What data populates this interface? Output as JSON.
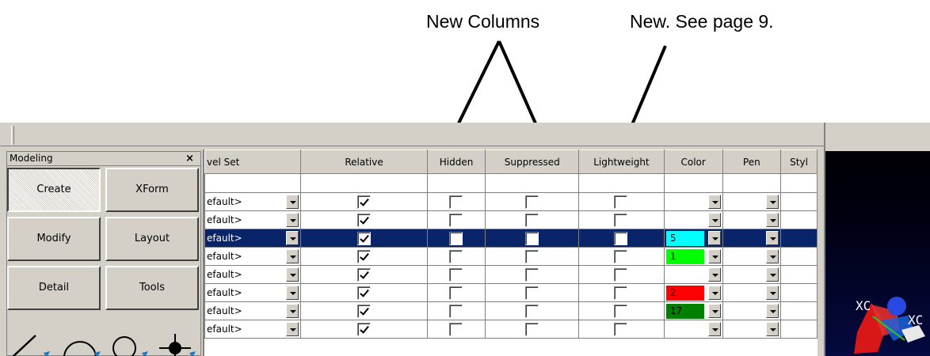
{
  "callouts": [
    {
      "text": "New Columns"
    },
    {
      "text": "New. See page 9."
    }
  ],
  "palette": {
    "title": "Modeling",
    "close_label": "×",
    "buttons": [
      {
        "label": "Create",
        "pressed": true
      },
      {
        "label": "XForm",
        "pressed": false
      },
      {
        "label": "Modify",
        "pressed": false
      },
      {
        "label": "Layout",
        "pressed": false
      },
      {
        "label": "Detail",
        "pressed": false
      },
      {
        "label": "Tools",
        "pressed": false
      }
    ],
    "tool_icons": [
      "line-icon",
      "arc-icon",
      "circle-icon",
      "point-icon"
    ]
  },
  "grid": {
    "columns": [
      "vel Set",
      "Relative",
      "Hidden",
      "Suppressed",
      "Lightweight",
      "Color",
      "Pen",
      "Styl"
    ],
    "rows": [
      {
        "level": "efault>",
        "relative": true,
        "hidden": false,
        "suppressed": false,
        "lightweight": false,
        "color": "",
        "color_hex": "",
        "selected": false
      },
      {
        "level": "efault>",
        "relative": true,
        "hidden": false,
        "suppressed": false,
        "lightweight": false,
        "color": "",
        "color_hex": "",
        "selected": false
      },
      {
        "level": "efault>",
        "relative": true,
        "hidden": false,
        "suppressed": false,
        "lightweight": false,
        "color": "5",
        "color_hex": "#00ffff",
        "selected": true
      },
      {
        "level": "efault>",
        "relative": true,
        "hidden": false,
        "suppressed": false,
        "lightweight": false,
        "color": "1",
        "color_hex": "#00ff00",
        "selected": false
      },
      {
        "level": "efault>",
        "relative": true,
        "hidden": false,
        "suppressed": false,
        "lightweight": false,
        "color": "",
        "color_hex": "",
        "selected": false
      },
      {
        "level": "efault>",
        "relative": true,
        "hidden": false,
        "suppressed": false,
        "lightweight": false,
        "color": "2",
        "color_hex": "#ff0000",
        "selected": false
      },
      {
        "level": "efault>",
        "relative": true,
        "hidden": false,
        "suppressed": false,
        "lightweight": false,
        "color": "17",
        "color_hex": "#008000",
        "selected": false
      },
      {
        "level": "efault>",
        "relative": true,
        "hidden": false,
        "suppressed": false,
        "lightweight": false,
        "color": "",
        "color_hex": "",
        "selected": false
      }
    ]
  },
  "viewport": {
    "axis_labels": [
      "XC",
      "XC"
    ]
  }
}
